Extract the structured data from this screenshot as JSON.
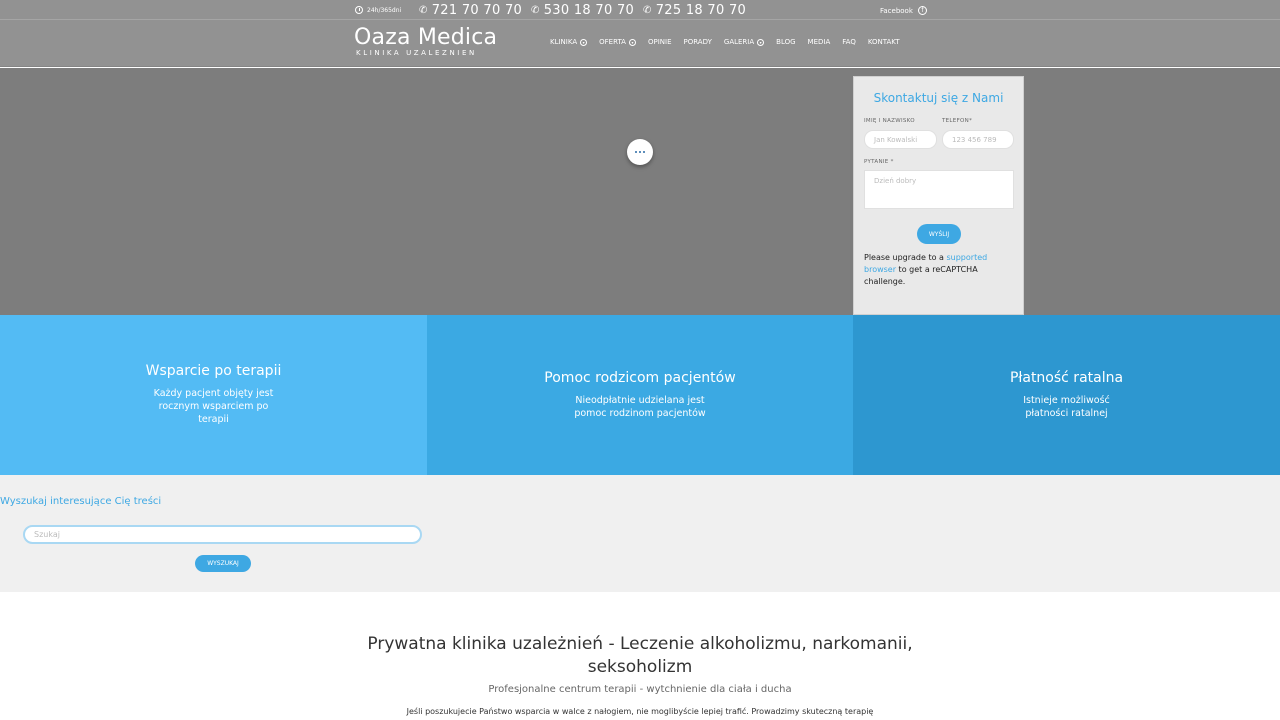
{
  "topbar": {
    "hours": "24h/365dni",
    "phones": [
      "721 70 70 70",
      "530 18 70 70",
      "725 18 70 70"
    ],
    "facebook": "Facebook"
  },
  "header": {
    "logo_title": "Oaza Medica",
    "logo_subtitle": "KLINIKA UZALEZNIEN",
    "nav": [
      {
        "label": "KLINIKA",
        "dropdown": true
      },
      {
        "label": "OFERTA",
        "dropdown": true
      },
      {
        "label": "OPINIE",
        "dropdown": false
      },
      {
        "label": "PORADY",
        "dropdown": false
      },
      {
        "label": "GALERIA",
        "dropdown": true
      },
      {
        "label": "BLOG",
        "dropdown": false
      },
      {
        "label": "MEDIA",
        "dropdown": false
      },
      {
        "label": "FAQ",
        "dropdown": false
      },
      {
        "label": "KONTAKT",
        "dropdown": false
      }
    ]
  },
  "contact_form": {
    "title": "Skontaktuj się z Nami",
    "name_label": "IMIĘ I NAZWISKO",
    "name_placeholder": "Jan Kowalski",
    "phone_label": "TELEFON*",
    "phone_placeholder": "123 456 789",
    "question_label": "PYTANIE *",
    "question_placeholder": "Dzień dobry",
    "send_label": "WYŚLIJ",
    "recaptcha_text_before": "Please upgrade to a ",
    "recaptcha_link": "supported browser",
    "recaptcha_text_after": " to get a reCAPTCHA challenge."
  },
  "features": [
    {
      "title": "Wsparcie po terapii",
      "text": "Każdy pacjent objęty jest rocznym wsparciem po terapii"
    },
    {
      "title": "Pomoc rodzicom pacjentów",
      "text": "Nieodpłatnie udzielana jest pomoc rodzinom pacjentów"
    },
    {
      "title": "Płatność ratalna",
      "text": "Istnieje możliwość płatności ratalnej"
    }
  ],
  "search": {
    "title": "Wyszukaj interesujące Cię treści",
    "placeholder": "Szukaj",
    "button_label": "WYSZUKAJ"
  },
  "main": {
    "title": "Prywatna klinika uzależnień - Leczenie alkoholizmu, narkomanii, seksoholizm",
    "subtitle": "Profesjonalne centrum terapii - wytchnienie dla ciała i ducha",
    "body": "Jeśli poszukujecie Państwo wsparcia w walce z nałogiem, nie moglibyście lepiej trafić. Prowadzimy skuteczną terapię"
  },
  "colors": {
    "accent": "#3ea8e3",
    "header_bg": "#929292",
    "hero_bg": "#7d7d7d",
    "feature_1": "#53bbf4",
    "feature_2": "#3ba9e3",
    "feature_3": "#2d97d0"
  }
}
